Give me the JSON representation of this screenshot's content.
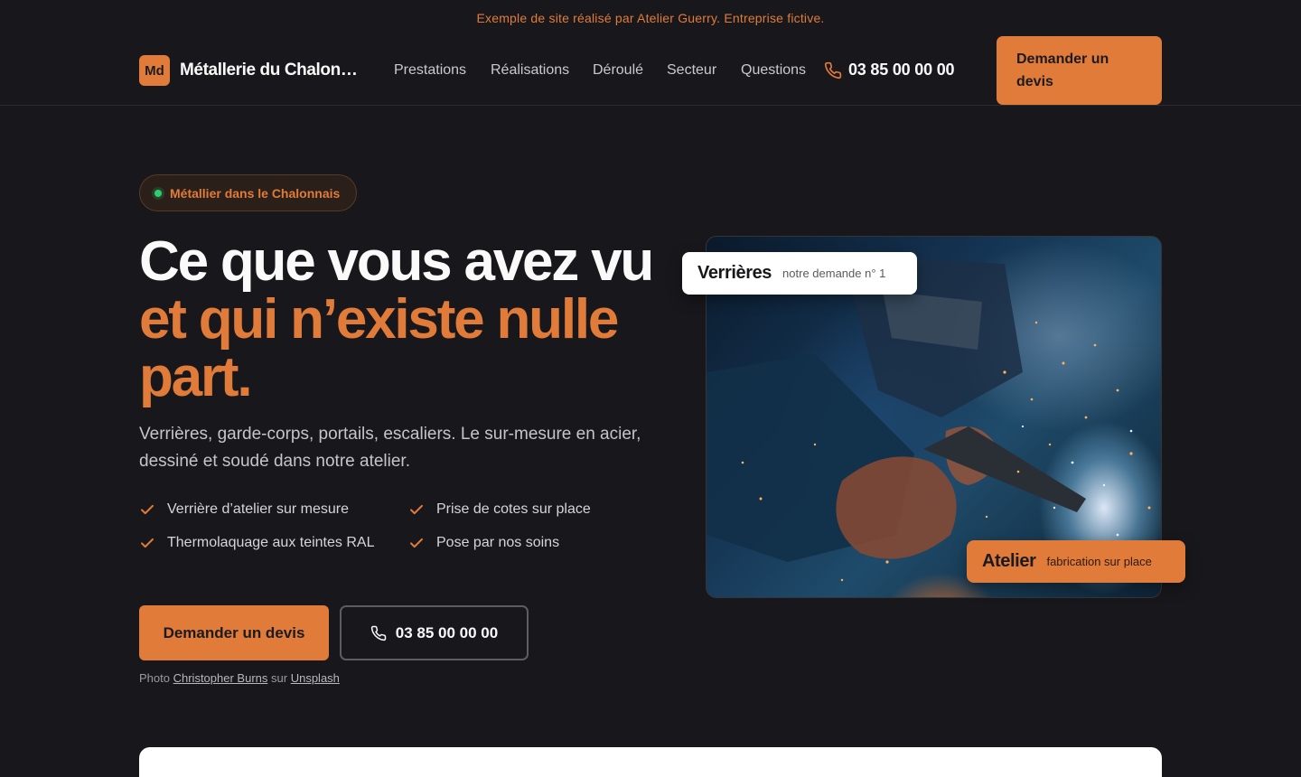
{
  "topbar": {
    "text": "Exemple de site réalisé par Atelier Guerry. Entreprise fictive."
  },
  "header": {
    "logo_initials": "Md",
    "brand_name": "Métallerie du Chalonn...",
    "nav": [
      {
        "label": "Prestations"
      },
      {
        "label": "Réalisations"
      },
      {
        "label": "Déroulé"
      },
      {
        "label": "Secteur"
      },
      {
        "label": "Questions"
      }
    ],
    "phone": "03 85 00 00 00",
    "phone_icon": "phone-icon",
    "cta_label": "Demander un devis"
  },
  "hero": {
    "badge": "Métallier dans le Chalonnais",
    "title_line1": "Ce que vous avez vu",
    "title_line2": "et qui n’existe nulle part.",
    "lead": "Verrières, garde-corps, portails, escaliers. Le sur-mesure en acier, dessiné et soudé dans notre atelier.",
    "features": [
      {
        "label": "Verrière d’atelier sur mesure"
      },
      {
        "label": "Prise de cotes sur place"
      },
      {
        "label": "Thermolaquage aux teintes RAL"
      },
      {
        "label": "Pose par nos soins"
      }
    ],
    "primary_cta": "Demander un devis",
    "phone_cta": "03 85 00 00 00",
    "credit_prefix": "Photo",
    "credit_author": "Christopher Burns",
    "credit_mid": "sur",
    "credit_site": "Unsplash"
  },
  "photo_tags": {
    "top_title": "Verrières",
    "top_sub": "notre demande n° 1",
    "bottom_title": "Atelier",
    "bottom_sub": "fabrication sur place"
  },
  "colors": {
    "accent": "#e07b39",
    "background": "#18181c",
    "status_dot": "#2ecc71"
  }
}
